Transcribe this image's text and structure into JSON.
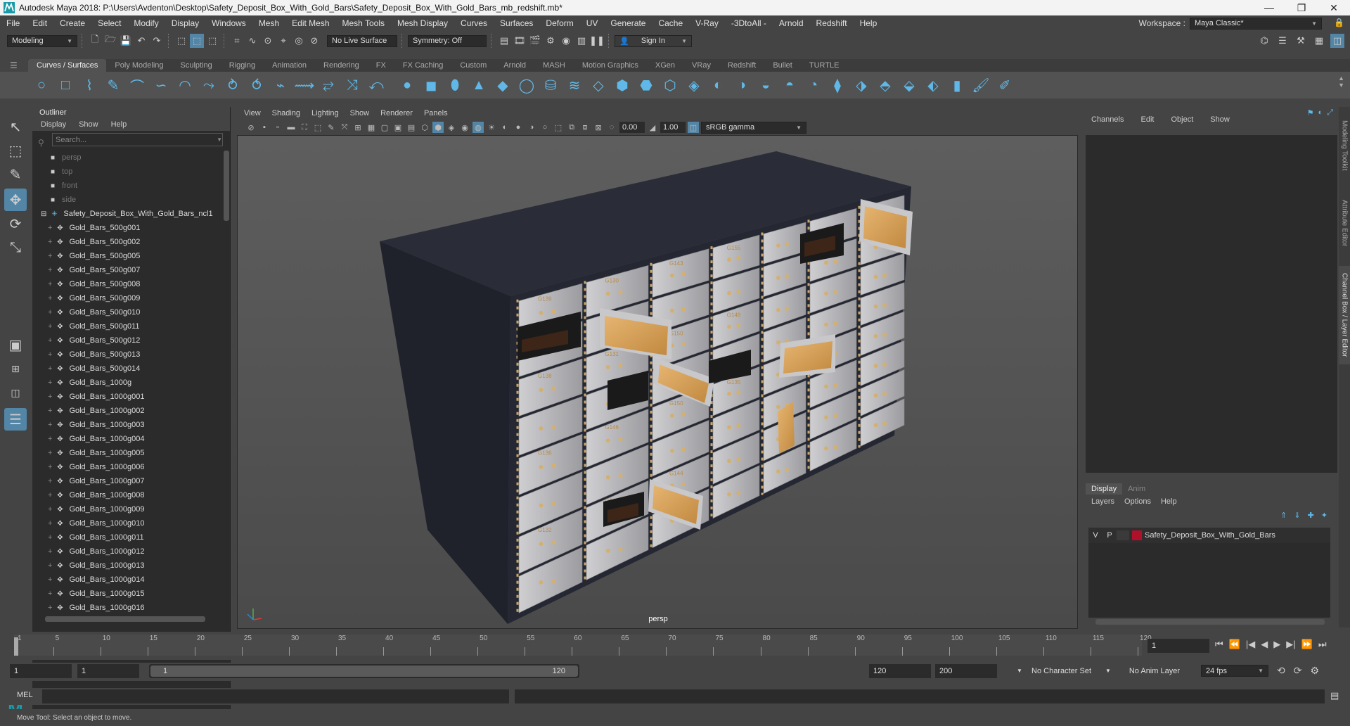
{
  "window": {
    "title": "Autodesk Maya 2018: P:\\Users\\Avdenton\\Desktop\\Safety_Deposit_Box_With_Gold_Bars\\Safety_Deposit_Box_With_Gold_Bars_mb_redshift.mb*",
    "minimize": "—",
    "maximize": "❐",
    "close": "✕"
  },
  "menubar": {
    "items": [
      "File",
      "Edit",
      "Create",
      "Select",
      "Modify",
      "Display",
      "Windows",
      "Mesh",
      "Edit Mesh",
      "Mesh Tools",
      "Mesh Display",
      "Curves",
      "Surfaces",
      "Deform",
      "UV",
      "Generate",
      "Cache",
      "V-Ray",
      "-3DtoAll -",
      "Arnold",
      "Redshift",
      "Help"
    ],
    "workspace_label": "Workspace :",
    "workspace_value": "Maya Classic*"
  },
  "statusline": {
    "mode": "Modeling",
    "live_surface": "No Live Surface",
    "symmetry": "Symmetry: Off",
    "sign_in": "Sign In"
  },
  "shelf": {
    "tabs": [
      "Curves / Surfaces",
      "Poly Modeling",
      "Sculpting",
      "Rigging",
      "Animation",
      "Rendering",
      "FX",
      "FX Caching",
      "Custom",
      "Arnold",
      "MASH",
      "Motion Graphics",
      "XGen",
      "VRay",
      "Redshift",
      "Bullet",
      "TURTLE"
    ],
    "active_tab": "Curves / Surfaces"
  },
  "outliner": {
    "title": "Outliner",
    "menus": [
      "Display",
      "Show",
      "Help"
    ],
    "search_placeholder": "Search...",
    "cameras": [
      "persp",
      "top",
      "front",
      "side"
    ],
    "group": "Safety_Deposit_Box_With_Gold_Bars_ncl1",
    "items": [
      "Gold_Bars_500g001",
      "Gold_Bars_500g002",
      "Gold_Bars_500g005",
      "Gold_Bars_500g007",
      "Gold_Bars_500g008",
      "Gold_Bars_500g009",
      "Gold_Bars_500g010",
      "Gold_Bars_500g011",
      "Gold_Bars_500g012",
      "Gold_Bars_500g013",
      "Gold_Bars_500g014",
      "Gold_Bars_1000g",
      "Gold_Bars_1000g001",
      "Gold_Bars_1000g002",
      "Gold_Bars_1000g003",
      "Gold_Bars_1000g004",
      "Gold_Bars_1000g005",
      "Gold_Bars_1000g006",
      "Gold_Bars_1000g007",
      "Gold_Bars_1000g008",
      "Gold_Bars_1000g009",
      "Gold_Bars_1000g010",
      "Gold_Bars_1000g011",
      "Gold_Bars_1000g012",
      "Gold_Bars_1000g013",
      "Gold_Bars_1000g014",
      "Gold_Bars_1000g015",
      "Gold_Bars_1000g016"
    ]
  },
  "viewport": {
    "menus": [
      "View",
      "Shading",
      "Lighting",
      "Show",
      "Renderer",
      "Panels"
    ],
    "exposure": "0.00",
    "gamma": "1.00",
    "color_space": "sRGB gamma",
    "camera_label": "persp",
    "box_labels": [
      "G139",
      "G138",
      "G136",
      "G132",
      "G130",
      "G131",
      "G146",
      "G149",
      "G143",
      "G150",
      "G150",
      "G144",
      "G155",
      "G148",
      "G135"
    ]
  },
  "channelbox": {
    "menus": [
      "Channels",
      "Edit",
      "Object",
      "Show"
    ]
  },
  "layers": {
    "tabs": [
      "Display",
      "Anim"
    ],
    "active_tab": "Display",
    "menus": [
      "Layers",
      "Options",
      "Help"
    ],
    "layer_v": "V",
    "layer_p": "P",
    "layer_name": "Safety_Deposit_Box_With_Gold_Bars",
    "layer_color": "#b0102a"
  },
  "sidetabs": [
    "Modeling Toolkit",
    "Attribute Editor",
    "Channel Box / Layer Editor"
  ],
  "timeline": {
    "ticks": [
      "1",
      "5",
      "10",
      "15",
      "20",
      "25",
      "30",
      "35",
      "40",
      "45",
      "50",
      "55",
      "60",
      "65",
      "70",
      "75",
      "80",
      "85",
      "90",
      "95",
      "100",
      "105",
      "110",
      "115",
      "120"
    ],
    "current_frame": "1"
  },
  "range": {
    "start": "1",
    "playback_start": "1",
    "slider_start": "1",
    "slider_end": "120",
    "playback_end": "120",
    "end": "200",
    "character_set": "No Character Set",
    "anim_layer": "No Anim Layer",
    "fps": "24 fps"
  },
  "cmdline": {
    "label": "MEL"
  },
  "helpline": {
    "text": "Move Tool: Select an object to move."
  },
  "colors": {
    "accent": "#5285a6",
    "shelf_icon": "#5fb8e8",
    "cabinet_body": "#272a35",
    "box_face": "#b8b8bc",
    "gold": "#d9a55a"
  }
}
